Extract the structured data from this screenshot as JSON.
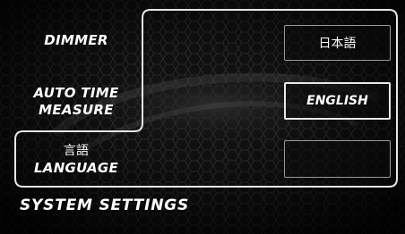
{
  "menu": {
    "dimmer_label": "DIMMER",
    "auto_time_measure_line1": "AUTO TIME",
    "auto_time_measure_line2": "MEASURE",
    "language_jp": "言語",
    "language_en": "LANGUAGE"
  },
  "options": {
    "japanese_label": "日本語",
    "english_label": "ENGLISH",
    "empty_label": "",
    "selected": "ENGLISH"
  },
  "footer": {
    "title": "SYSTEM SETTINGS"
  },
  "colors": {
    "background": "#0d0d0d",
    "outline": "#e6e6e6",
    "text": "#ffffff",
    "button_border": "#9a9a9a"
  }
}
